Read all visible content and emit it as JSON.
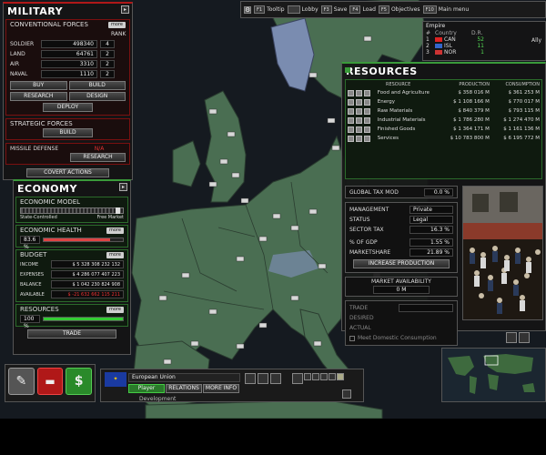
{
  "topbar": {
    "items": [
      {
        "key": "F1",
        "label": "Tooltip"
      },
      {
        "key": "",
        "label": "Lobby"
      },
      {
        "key": "F3",
        "label": "Save"
      },
      {
        "key": "F4",
        "label": "Load"
      },
      {
        "key": "F5",
        "label": "Objectives"
      },
      {
        "key": "F10",
        "label": "Main menu"
      }
    ]
  },
  "empire": {
    "title": "Empire",
    "headers": [
      "#",
      "Country",
      "D.R."
    ],
    "rows": [
      {
        "rank": "1",
        "code": "CAN",
        "dr": "52"
      },
      {
        "rank": "2",
        "code": "ISL",
        "dr": "11"
      },
      {
        "rank": "3",
        "code": "NOR",
        "dr": "1"
      }
    ],
    "status": "Ally"
  },
  "military": {
    "title": "MILITARY",
    "conventional": "CONVENTIONAL FORCES",
    "more": "more",
    "rank_header": "RANK",
    "rows": [
      {
        "label": "SOLDIER",
        "value": "498340",
        "rank": "4"
      },
      {
        "label": "LAND",
        "value": "64761",
        "rank": "2"
      },
      {
        "label": "AIR",
        "value": "3310",
        "rank": "2"
      },
      {
        "label": "NAVAL",
        "value": "1110",
        "rank": "2"
      }
    ],
    "buy": "BUY",
    "build": "BUILD",
    "research": "RESEARCH",
    "design": "DESIGN",
    "deploy": "DEPLOY",
    "strategic": "STRATEGIC FORCES",
    "strategic_build": "BUILD",
    "missile_defense": "MISSILE DEFENSE",
    "missile_value": "N/A",
    "missile_research": "RESEARCH",
    "covert": "COVERT ACTIONS"
  },
  "economy": {
    "title": "ECONOMY",
    "model": "ECONOMIC MODEL",
    "state_label": "State-Controlled",
    "free_label": "Free Market",
    "model_position": 0.97,
    "health": "ECONOMIC HEALTH",
    "health_more": "more",
    "health_value": "83.6 %",
    "health_fraction": 0.836,
    "budget": "BUDGET",
    "budget_more": "more",
    "budget_rows": [
      {
        "label": "INCOME",
        "value": "$ 5 328 308 232 132"
      },
      {
        "label": "EXPENSES",
        "value": "$ 4 286 077 407 223"
      },
      {
        "label": "BALANCE",
        "value": "$ 1 042 230 824 908"
      },
      {
        "label": "AVAILABLE",
        "value": "$ -21 632 662 115 211"
      }
    ],
    "resources": "RESOURCES",
    "resources_more": "more",
    "resources_value": "100 %",
    "resources_fraction": 1.0,
    "trade": "TRADE"
  },
  "resources": {
    "title": "RESOURCES",
    "headers": [
      "RESOURCE",
      "PRODUCTION",
      "CONSUMPTION"
    ],
    "rows": [
      {
        "name": "Food and Agriculture",
        "production": "$ 358 016 M",
        "consumption": "$ 361 253 M"
      },
      {
        "name": "Energy",
        "production": "$ 1 108 166 M",
        "consumption": "$ 770 017 M"
      },
      {
        "name": "Raw Materials",
        "production": "$ 840 379 M",
        "consumption": "$ 793 115 M"
      },
      {
        "name": "Industrial Materials",
        "production": "$ 1 786 280 M",
        "consumption": "$ 1 274 470 M"
      },
      {
        "name": "Finished Goods",
        "production": "$ 1 364 171 M",
        "consumption": "$ 1 161 136 M"
      },
      {
        "name": "Services",
        "production": "$ 10 783 800 M",
        "consumption": "$ 6 195 772 M"
      }
    ],
    "global_tax": "GLOBAL TAX MOD",
    "global_tax_value": "0.0 %",
    "management": "MANAGEMENT",
    "management_value": "Private",
    "status": "STATUS",
    "status_value": "Legal",
    "sector_tax": "SECTOR TAX",
    "sector_tax_value": "16.3 %",
    "gdp": "% OF GDP",
    "gdp_value": "1.55 %",
    "share": "MARKETSHARE",
    "share_value": "21.89 %",
    "increase": "INCREASE PRODUCTION",
    "market": "MARKET AVAILABILITY",
    "market_value": "0 M",
    "trade": "TRADE",
    "desired": "DESIRED",
    "actual": "ACTUAL",
    "meet": "Meet Domestic Consumption"
  },
  "bottom": {
    "country": "European Union",
    "tab_player": "Player",
    "tab_relations": "RELATIONS",
    "tab_more": "MORE INFO",
    "development": "Development"
  },
  "colors": {
    "military": "#b01818",
    "economy": "#3a9a3a",
    "land": "#4a6e52",
    "sea": "#161a20"
  }
}
